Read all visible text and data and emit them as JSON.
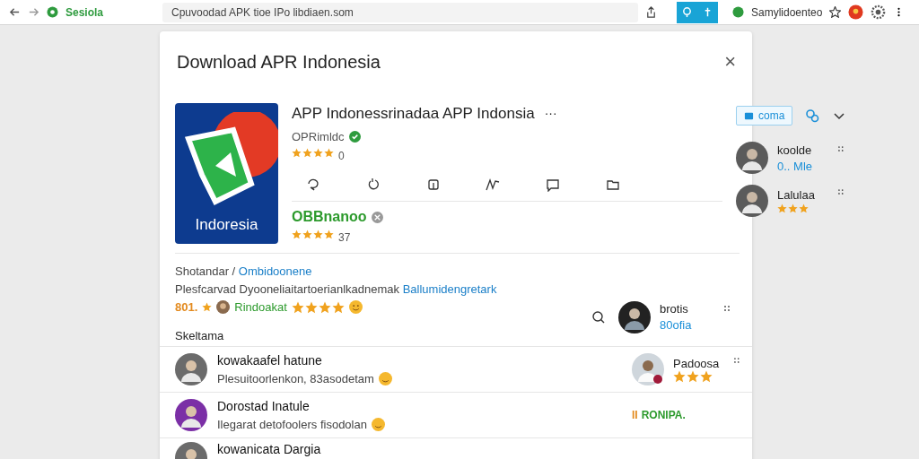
{
  "browser": {
    "tab_title": "Sesiola",
    "address": "Cpuvoodad APK tioe IPo libdiaen.som",
    "profile_name": "Samylidoenteo"
  },
  "dialog": {
    "title": "Download APR Indonesia",
    "close": "×"
  },
  "app": {
    "icon_label": "Indoresia",
    "name": "APP Indonessrinadaa APP Indonsia",
    "more": "···",
    "developer": "OPRimldc",
    "verified": true,
    "stars": 4,
    "rating": "0",
    "action_button": "coma"
  },
  "publisher": {
    "name": "OBBnanoo",
    "stars": 4,
    "rating": "37"
  },
  "people": [
    {
      "name": "koolde",
      "kind": "text",
      "sub": "0.. Mle"
    },
    {
      "name": "Lalulaa",
      "kind": "stars",
      "stars": 3
    }
  ],
  "description": {
    "line1": "Shotandar / ",
    "link1": "Ombidoonene",
    "line2": "Plesfcarvad Dyooneliaitartoerianlkadnemak",
    "link2": "Ballumidengretark",
    "section_label": "Skeltama"
  },
  "score": {
    "text": "801."
  },
  "reviewer": {
    "name": "Rindoakat",
    "stars": 4
  },
  "side_person": {
    "name": "brotis",
    "kind": "text",
    "sub": "80ofia"
  },
  "rows": [
    {
      "title": "kowakaafel hatune",
      "subtitle": "Plesuitoorlenkon, 83asodetam",
      "right": {
        "kind": "person",
        "name": "Padoosa",
        "stars": 3
      }
    },
    {
      "title": "Dorostad Inatule",
      "subtitle": "Ilegarat detofoolers fisodolan",
      "right": {
        "kind": "tag",
        "prefix": "II",
        "text": "RONIPA."
      }
    },
    {
      "title": "kowanicata Dargia",
      "right": {
        "kind": "none"
      }
    }
  ]
}
